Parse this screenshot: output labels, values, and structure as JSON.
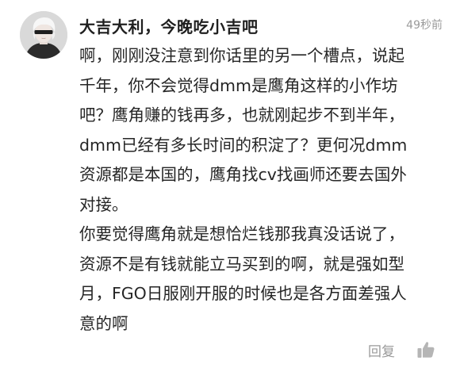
{
  "comment": {
    "username": "大吉大利，今晚吃小吉吧",
    "timestamp": "49秒前",
    "lines": [
      "啊，刚刚没注意到你话里的另一个槽点，说起",
      "千年，你不会觉得dmm是鹰角这样的小作坊",
      "吧？鹰角赚的钱再多，也就刚起步不到半年，",
      "dmm已经有多长时间的积淀了？更何况dmm",
      "资源都是本国的，鹰角找cv找画师还要去国外",
      "对接。",
      "你要觉得鹰角就是想恰烂钱那我真没话说了，",
      "资源不是有钱就能立马买到的啊，就是强如型",
      "月，FGO日服刚开服的时候也是各方面差强人",
      "意的啊"
    ],
    "reply_label": "回复",
    "like_icon": "thumbs-up-icon",
    "avatar_icon": "avatar-white-hair-blindfold"
  }
}
